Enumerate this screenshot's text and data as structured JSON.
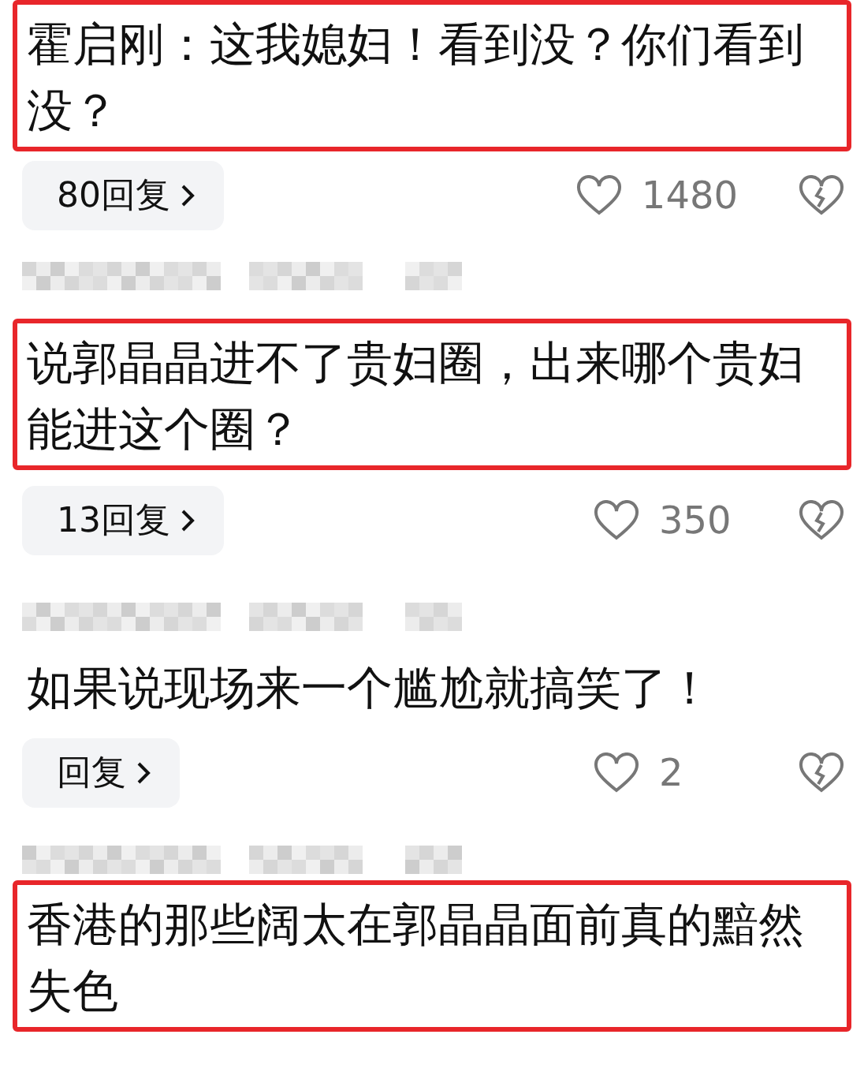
{
  "comments": [
    {
      "highlighted": true,
      "text": "霍启刚：这我媳妇！看到没？你们看到没？",
      "replies": "80回复",
      "likes": "1480"
    },
    {
      "author_visible": true,
      "highlighted": true,
      "text": "说郭晶晶进不了贵妇圈，出来哪个贵妇能进这个圈？",
      "replies": "13回复",
      "likes": "350"
    },
    {
      "author_visible": true,
      "highlighted": false,
      "text": "如果说现场来一个尴尬就搞笑了！",
      "replies": "回复",
      "likes": "2"
    },
    {
      "author_visible": true,
      "highlighted": true,
      "text": "香港的那些阔太在郭晶晶面前真的黯然失色"
    }
  ]
}
